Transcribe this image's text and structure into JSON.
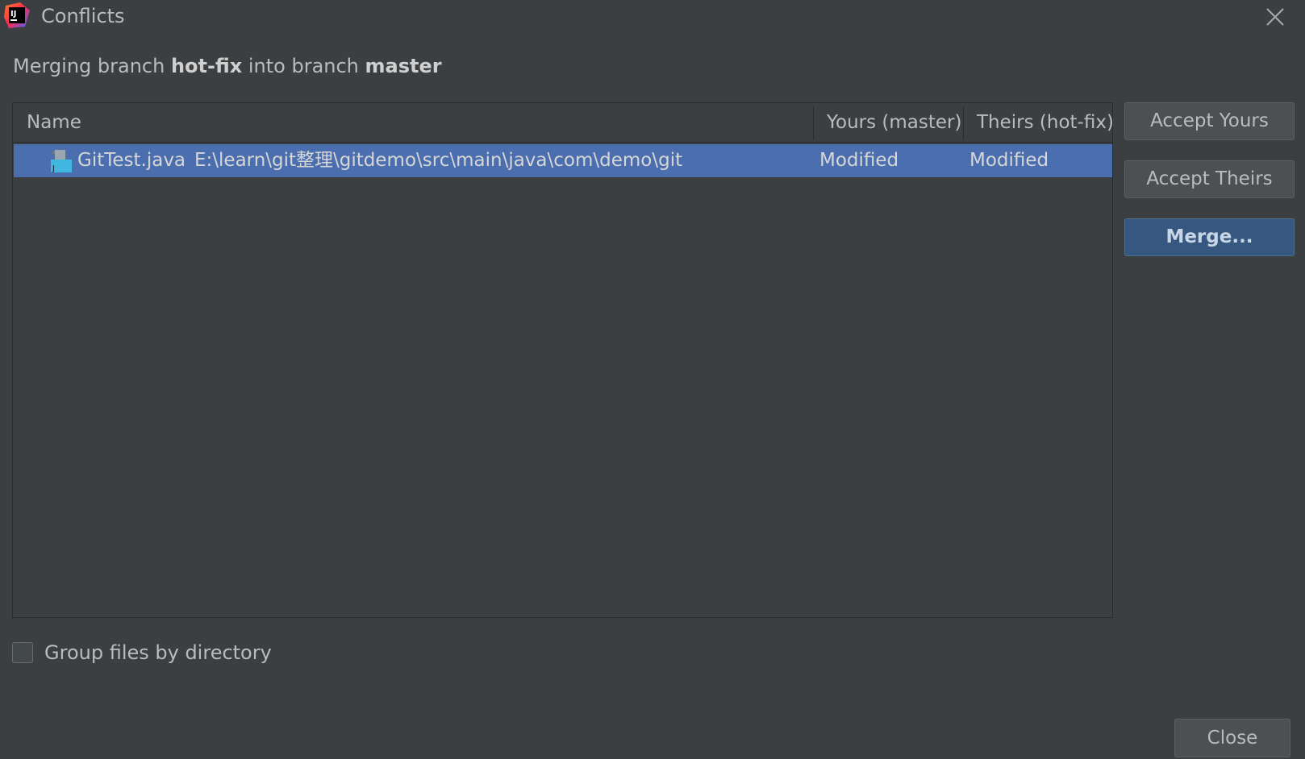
{
  "window": {
    "title": "Conflicts",
    "close_icon": "close-icon",
    "app_icon": "intellij-logo-icon"
  },
  "header": {
    "prefix": "Merging branch ",
    "source_branch": "hot-fix",
    "middle": " into branch ",
    "target_branch": "master"
  },
  "table": {
    "columns": {
      "name": "Name",
      "yours": "Yours (master)",
      "theirs": "Theirs (hot-fix)"
    },
    "rows": [
      {
        "icon": "java-file-icon",
        "filename": "GitTest.java",
        "path": "E:\\learn\\git整理\\gitdemo\\src\\main\\java\\com\\demo\\git",
        "yours": "Modified",
        "theirs": "Modified",
        "selected": true
      }
    ]
  },
  "actions": {
    "accept_yours": "Accept Yours",
    "accept_theirs": "Accept Theirs",
    "merge": "Merge..."
  },
  "options": {
    "group_by_directory_label": "Group files by directory",
    "group_by_directory_checked": false
  },
  "footer": {
    "close_label": "Close"
  },
  "colors": {
    "background": "#3c3f41",
    "selection": "#4b6eaf",
    "default_button": "#365880",
    "text": "#bbbbbb"
  }
}
